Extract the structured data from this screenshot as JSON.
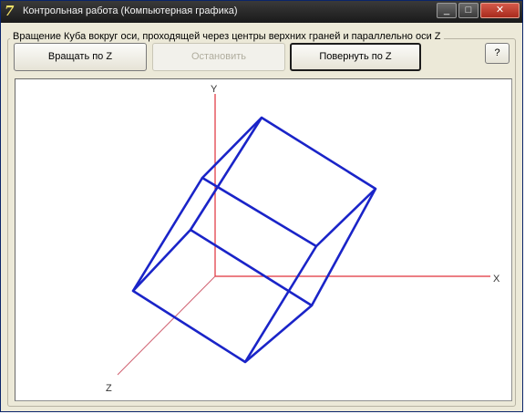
{
  "window": {
    "title": "Контрольная работа (Компьютерная графика)",
    "controls": {
      "minimize": "_",
      "maximize": "□",
      "close": "✕"
    }
  },
  "group": {
    "label": "Вращение Куба вокруг оси, проходящей через центры верхних граней и параллельно оси Z"
  },
  "buttons": {
    "rotate_z": "Вращать по Z",
    "stop": "Остановить",
    "turn_z": "Повернуть по Z",
    "help": "?"
  },
  "scene": {
    "axis_labels": {
      "x": "X",
      "y": "Y",
      "z": "Z"
    },
    "colors": {
      "axis": "#e0303a",
      "cube": "#1a24c8",
      "z_axis": "#d06070"
    }
  }
}
